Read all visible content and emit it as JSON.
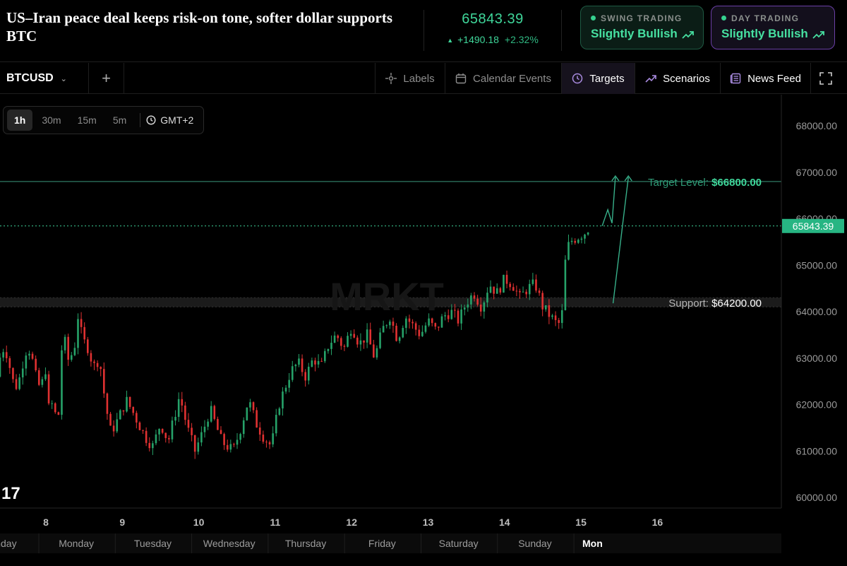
{
  "header": {
    "headline": "US–Iran peace deal keeps risk-on tone, softer dollar supports BTC",
    "price": "65843.39",
    "change": "+1490.18",
    "change_pct": "+2.32%",
    "swing": {
      "label": "SWING TRADING",
      "value": "Slightly Bullish"
    },
    "day": {
      "label": "DAY TRADING",
      "value": "Slightly Bullish"
    }
  },
  "toolbar": {
    "symbol": "BTCUSD",
    "labels": "Labels",
    "calendar": "Calendar Events",
    "targets": "Targets",
    "scenarios": "Scenarios",
    "news": "News Feed"
  },
  "intervals": [
    "1h",
    "30m",
    "15m",
    "5m"
  ],
  "active_interval": "1h",
  "timezone": "GMT+2",
  "watermark": "MRKT",
  "colors": {
    "up": "#26a269",
    "down": "#e03131",
    "accent": "#3fd69a",
    "target_line": "#2f7a64",
    "support_zone": "#1b1b1b"
  },
  "chart_data": {
    "type": "candlestick",
    "y_axis": {
      "ticks": [
        "68000.00",
        "67000.00",
        "66000.00",
        "65000.00",
        "64000.00",
        "63000.00",
        "62000.00",
        "61000.00",
        "60000.00"
      ],
      "range": [
        59800,
        68500
      ]
    },
    "x_axis": {
      "day_ticks": [
        "8",
        "9",
        "10",
        "11",
        "12",
        "13",
        "14",
        "15",
        "16"
      ],
      "weekday_labels": [
        "Sunday",
        "Monday",
        "Tuesday",
        "Wednesday",
        "Thursday",
        "Friday",
        "Saturday",
        "Sunday",
        "Mon"
      ]
    },
    "current_price": 65843.39,
    "current_price_label": "65843.39",
    "target": {
      "label": "Target Level:",
      "value_label": "$66800.00",
      "value": 66800
    },
    "support": {
      "label": "Support:",
      "value_label": "$64200.00",
      "value": 64200
    },
    "path_points": [
      [
        0,
        62600
      ],
      [
        0.05,
        61700
      ],
      [
        0.1,
        62200
      ],
      [
        0.15,
        61300
      ],
      [
        0.22,
        63600
      ],
      [
        0.3,
        62900
      ],
      [
        0.38,
        63300
      ],
      [
        0.42,
        63900
      ],
      [
        0.48,
        63400
      ],
      [
        0.56,
        63200
      ],
      [
        0.62,
        62800
      ],
      [
        0.7,
        63000
      ],
      [
        0.78,
        62000
      ],
      [
        0.85,
        61400
      ],
      [
        0.95,
        61700
      ],
      [
        1.05,
        62100
      ],
      [
        1.15,
        61800
      ],
      [
        1.3,
        61300
      ],
      [
        1.4,
        61100
      ],
      [
        1.5,
        61600
      ],
      [
        1.6,
        61200
      ],
      [
        1.75,
        62200
      ],
      [
        1.85,
        61500
      ],
      [
        1.95,
        61000
      ],
      [
        2.05,
        61400
      ],
      [
        2.15,
        61900
      ],
      [
        2.3,
        61200
      ],
      [
        2.45,
        61000
      ],
      [
        2.55,
        61500
      ],
      [
        2.65,
        62100
      ],
      [
        2.75,
        61600
      ],
      [
        2.85,
        61300
      ],
      [
        2.95,
        61100
      ],
      [
        3.05,
        62000
      ],
      [
        3.2,
        62700
      ],
      [
        3.3,
        62900
      ],
      [
        3.4,
        62600
      ],
      [
        3.5,
        63000
      ],
      [
        3.6,
        62800
      ],
      [
        3.7,
        63300
      ],
      [
        3.8,
        63500
      ],
      [
        3.9,
        63200
      ],
      [
        4.0,
        63700
      ],
      [
        4.1,
        63300
      ],
      [
        4.2,
        63500
      ],
      [
        4.3,
        63000
      ],
      [
        4.4,
        63600
      ],
      [
        4.5,
        63900
      ],
      [
        4.6,
        63400
      ],
      [
        4.7,
        63900
      ],
      [
        4.8,
        63700
      ],
      [
        4.9,
        63500
      ],
      [
        5.0,
        63800
      ],
      [
        5.1,
        63600
      ],
      [
        5.2,
        63900
      ],
      [
        5.3,
        64000
      ],
      [
        5.4,
        63800
      ],
      [
        5.5,
        64200
      ],
      [
        5.6,
        64400
      ],
      [
        5.7,
        64100
      ],
      [
        5.8,
        64600
      ],
      [
        5.9,
        64400
      ],
      [
        6.0,
        64700
      ],
      [
        6.1,
        64600
      ],
      [
        6.2,
        64300
      ],
      [
        6.3,
        64500
      ],
      [
        6.4,
        64600
      ],
      [
        6.5,
        64100
      ],
      [
        6.6,
        63900
      ],
      [
        6.7,
        63700
      ],
      [
        6.75,
        63900
      ],
      [
        6.8,
        65200
      ],
      [
        6.85,
        65500
      ],
      [
        6.95,
        65600
      ],
      [
        7.05,
        65700
      ],
      [
        7.12,
        65843
      ]
    ]
  }
}
